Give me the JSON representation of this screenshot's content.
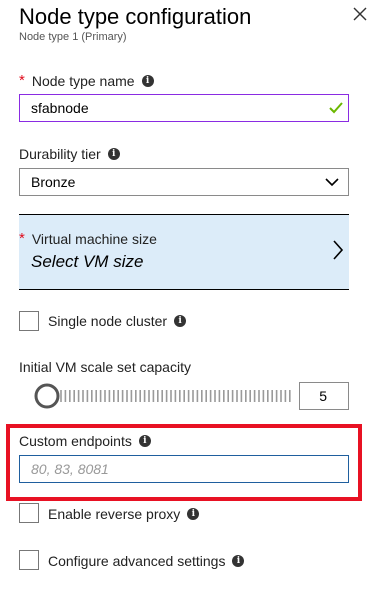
{
  "header": {
    "title": "Node type configuration",
    "subtitle": "Node type 1 (Primary)"
  },
  "node_type_name": {
    "label": "Node type name",
    "required_marker": "*",
    "value": "sfabnode",
    "validation_color": "#6bb700"
  },
  "durability_tier": {
    "label": "Durability tier",
    "selected": "Bronze"
  },
  "vm_size": {
    "label": "Virtual machine size",
    "required_marker": "*",
    "value": "Select VM size"
  },
  "single_node_cluster": {
    "label": "Single node cluster",
    "checked": false
  },
  "scale_set_capacity": {
    "label": "Initial VM scale set capacity",
    "value": "5",
    "slider_fraction": 0.0
  },
  "custom_endpoints": {
    "label": "Custom endpoints",
    "placeholder": "80, 83, 8081",
    "highlight_color": "#e81123"
  },
  "reverse_proxy": {
    "label": "Enable reverse proxy",
    "checked": false
  },
  "advanced_settings": {
    "label": "Configure advanced settings",
    "checked": false
  },
  "icons": {
    "info": "i",
    "close": "close-icon",
    "chevron_down": "chevron-down-icon",
    "chevron_right": "chevron-right-icon",
    "check": "check-icon"
  }
}
